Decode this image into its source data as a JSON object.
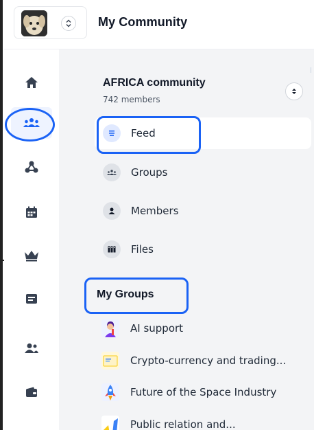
{
  "header": {
    "title": "My Community",
    "avatar_icon": "dog-avatar",
    "switch_icon": "chevron-up-down-icon"
  },
  "rail": {
    "items": [
      {
        "name": "home",
        "icon": "home-icon"
      },
      {
        "name": "community",
        "icon": "users-group-icon",
        "active": true
      },
      {
        "name": "network",
        "icon": "network-icon"
      },
      {
        "name": "calendar",
        "icon": "calendar-icon"
      },
      {
        "name": "premium",
        "icon": "crown-icon"
      },
      {
        "name": "inbox",
        "icon": "inbox-icon"
      },
      {
        "name": "contacts",
        "icon": "users-icon"
      },
      {
        "name": "wallet",
        "icon": "wallet-icon"
      }
    ],
    "accent": "#1a62f5"
  },
  "community": {
    "name": "AFRICA community",
    "members": "742 members"
  },
  "nav": {
    "items": [
      {
        "label": "Feed",
        "icon": "feed-icon",
        "active": true
      },
      {
        "label": "Groups",
        "icon": "groups-icon"
      },
      {
        "label": "Members",
        "icon": "member-icon"
      },
      {
        "label": "Files",
        "icon": "files-icon"
      }
    ]
  },
  "my_groups": {
    "title": "My Groups",
    "items": [
      {
        "label": "AI support",
        "icon": "ai-avatar-icon"
      },
      {
        "label": "Crypto-currency and trading...",
        "icon": "document-icon"
      },
      {
        "label": "Future of the Space Industry",
        "icon": "rocket-icon"
      },
      {
        "label": "Public relation and...",
        "icon": "pr-icon"
      }
    ]
  }
}
